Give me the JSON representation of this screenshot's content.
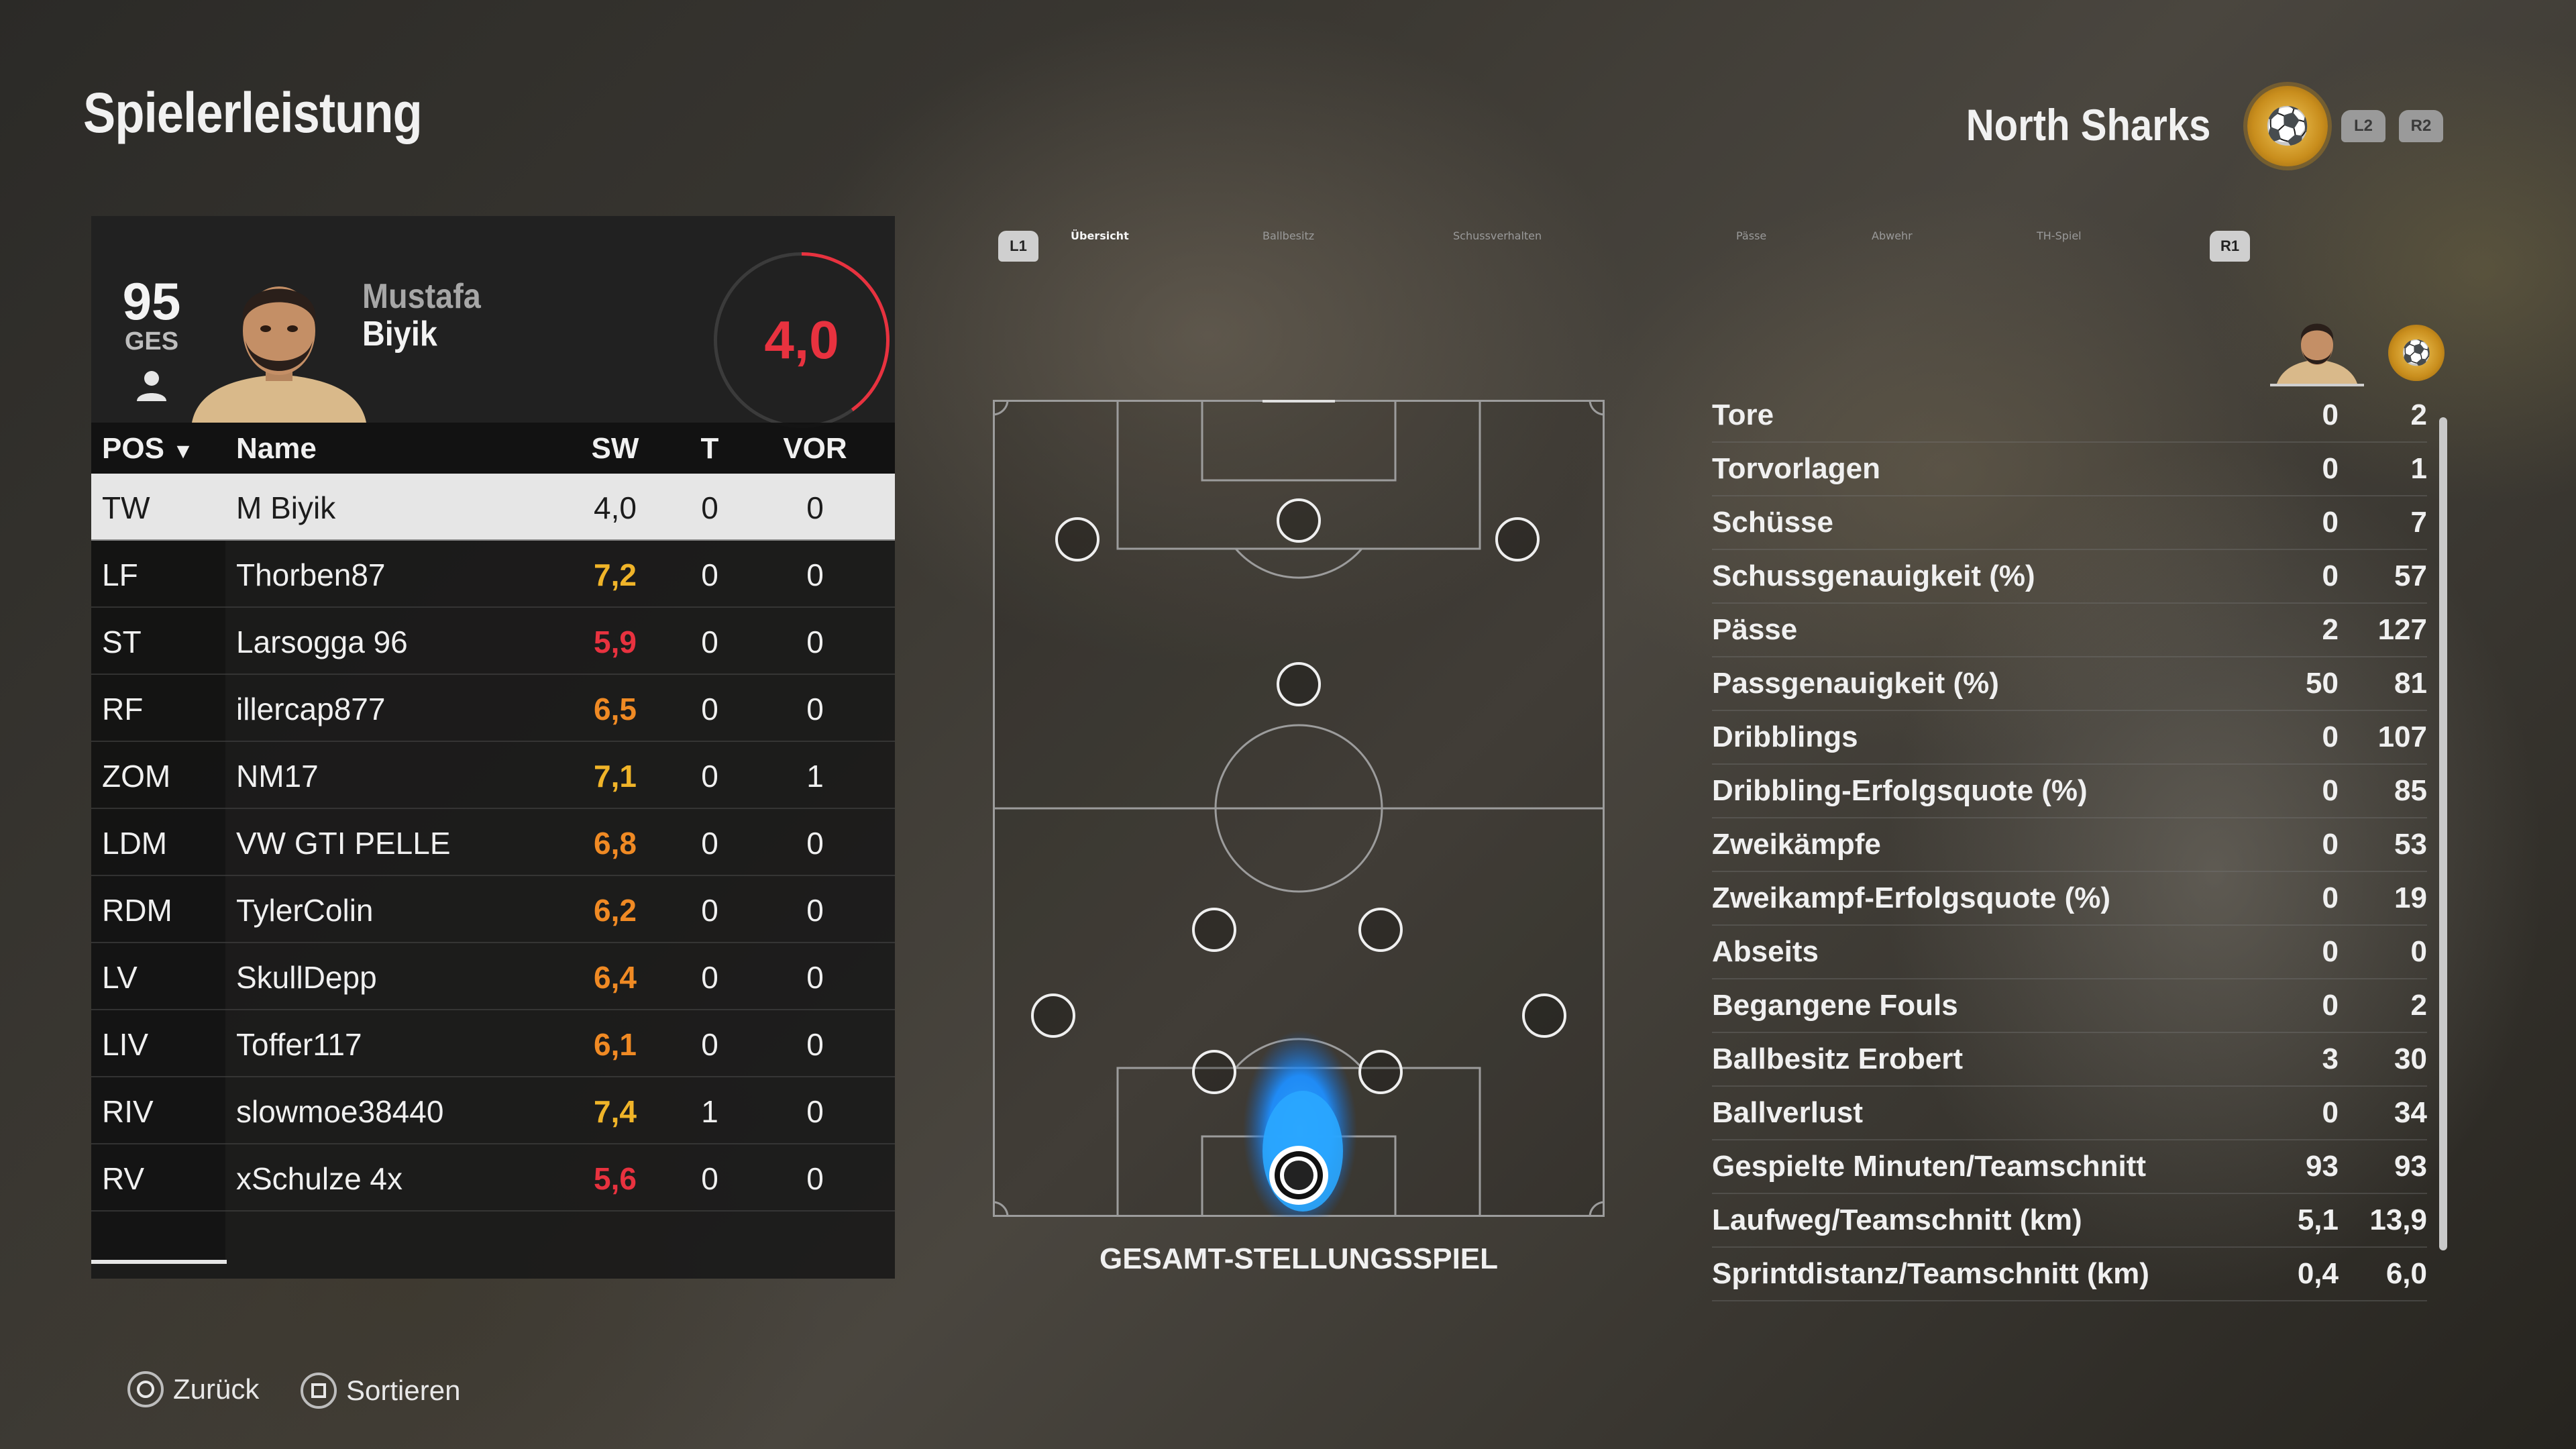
{
  "header": {
    "title": "Spielerleistung",
    "team_name": "North Sharks",
    "l2": "L2",
    "r2": "R2"
  },
  "player": {
    "overall": "95",
    "overall_label": "GES",
    "first_name": "Mustafa",
    "last_name": "Biyik",
    "rating": "4,0",
    "rating_value": 4.0,
    "rating_max": 10
  },
  "table": {
    "headers": {
      "pos": "POS",
      "name": "Name",
      "sw": "SW",
      "t": "T",
      "vor": "VOR"
    },
    "rows": [
      {
        "pos": "TW",
        "name": "M Biyik",
        "sw": "4,0",
        "t": "0",
        "vor": "0",
        "color": "#1c1c1c"
      },
      {
        "pos": "LF",
        "name": "Thorben87",
        "sw": "7,2",
        "t": "0",
        "vor": "0",
        "color": "#f0b429"
      },
      {
        "pos": "ST",
        "name": "Larsogga 96",
        "sw": "5,9",
        "t": "0",
        "vor": "0",
        "color": "#e8323f"
      },
      {
        "pos": "RF",
        "name": "illercap877",
        "sw": "6,5",
        "t": "0",
        "vor": "0",
        "color": "#f08a24"
      },
      {
        "pos": "ZOM",
        "name": "NM17",
        "sw": "7,1",
        "t": "0",
        "vor": "1",
        "color": "#f0b429"
      },
      {
        "pos": "LDM",
        "name": "VW GTI PELLE",
        "sw": "6,8",
        "t": "0",
        "vor": "0",
        "color": "#f08a24"
      },
      {
        "pos": "RDM",
        "name": "TylerColin",
        "sw": "6,2",
        "t": "0",
        "vor": "0",
        "color": "#f08a24"
      },
      {
        "pos": "LV",
        "name": "SkullDepp",
        "sw": "6,4",
        "t": "0",
        "vor": "0",
        "color": "#f08a24"
      },
      {
        "pos": "LIV",
        "name": "Toffer117",
        "sw": "6,1",
        "t": "0",
        "vor": "0",
        "color": "#f08a24"
      },
      {
        "pos": "RIV",
        "name": "slowmoe38440",
        "sw": "7,4",
        "t": "1",
        "vor": "0",
        "color": "#f0b429"
      },
      {
        "pos": "RV",
        "name": "xSchulze 4x",
        "sw": "5,6",
        "t": "0",
        "vor": "0",
        "color": "#e8323f"
      }
    ]
  },
  "tabs": {
    "l1": "L1",
    "r1": "R1",
    "items": [
      "Übersicht",
      "Ballbesitz",
      "Schussverhalten",
      "Pässe",
      "Abwehr",
      "TH-Spiel"
    ],
    "active": 0
  },
  "pitch": {
    "label": "GESAMT-STELLUNGSSPIEL"
  },
  "stats": [
    {
      "label": "Tore",
      "player": "0",
      "team": "2"
    },
    {
      "label": "Torvorlagen",
      "player": "0",
      "team": "1"
    },
    {
      "label": "Schüsse",
      "player": "0",
      "team": "7"
    },
    {
      "label": "Schussgenauigkeit (%)",
      "player": "0",
      "team": "57"
    },
    {
      "label": "Pässe",
      "player": "2",
      "team": "127"
    },
    {
      "label": "Passgenauigkeit (%)",
      "player": "50",
      "team": "81"
    },
    {
      "label": "Dribblings",
      "player": "0",
      "team": "107"
    },
    {
      "label": "Dribbling-Erfolgsquote (%)",
      "player": "0",
      "team": "85"
    },
    {
      "label": "Zweikämpfe",
      "player": "0",
      "team": "53"
    },
    {
      "label": "Zweikampf-Erfolgsquote (%)",
      "player": "0",
      "team": "19"
    },
    {
      "label": "Abseits",
      "player": "0",
      "team": "0"
    },
    {
      "label": "Begangene Fouls",
      "player": "0",
      "team": "2"
    },
    {
      "label": "Ballbesitz Erobert",
      "player": "3",
      "team": "30"
    },
    {
      "label": "Ballverlust",
      "player": "0",
      "team": "34"
    },
    {
      "label": "Gespielte Minuten/Teamschnitt",
      "player": "93",
      "team": "93"
    },
    {
      "label": "Laufweg/Teamschnitt (km)",
      "player": "5,1",
      "team": "13,9"
    },
    {
      "label": "Sprintdistanz/Teamschnitt (km)",
      "player": "0,4",
      "team": "6,0"
    }
  ],
  "footer": {
    "back": "Zurück",
    "sort": "Sortieren"
  },
  "colors": {
    "accent_red": "#e8323f",
    "accent_orange": "#f08a24",
    "accent_yellow": "#f0b429",
    "heatmap_blue": "#1e90ff"
  }
}
